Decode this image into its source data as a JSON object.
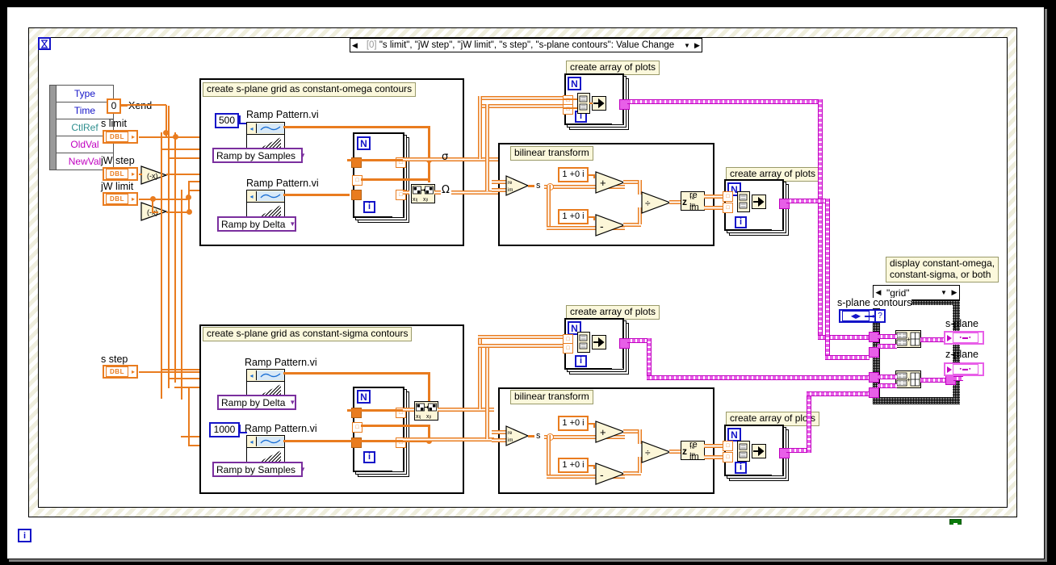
{
  "window": {
    "title_bar_text": "[0] \"s limit\", \"jW step\", \"jW limit\", \"s step\", \"s-plane contours\": Value Change",
    "title_index": "[0]",
    "left_arrow": "◀",
    "right_arrow": "▶",
    "dropdown_arrow": "▼",
    "timeout_icon": "⌛"
  },
  "event_data_node": {
    "items": [
      {
        "label": "Type",
        "color": "#1414c8"
      },
      {
        "label": "Time",
        "color": "#1414c8"
      },
      {
        "label": "CtlRef",
        "color": "#2f8f8f"
      },
      {
        "label": "OldVal",
        "color": "#c000c0"
      },
      {
        "label": "NewVal",
        "color": "#c000c0"
      }
    ]
  },
  "controls": {
    "xend_constant": "0",
    "xend_label": "Xend",
    "s_limit": {
      "label": "s limit",
      "type": "DBL"
    },
    "jw_step": {
      "label": "jW step",
      "type": "DBL"
    },
    "jw_limit": {
      "label": "jW limit",
      "type": "DBL"
    },
    "s_step": {
      "label": "s step",
      "type": "DBL"
    },
    "s_plane_contours": {
      "label": "s-plane contours"
    }
  },
  "frames": {
    "omega": {
      "comment": "create s-plane grid as constant-omega contours",
      "samples_constant": "500",
      "subvi_top": {
        "name": "Ramp Pattern.vi",
        "ring": "Ramp by Samples"
      },
      "subvi_bottom": {
        "name": "Ramp Pattern.vi",
        "ring": "Ramp by Delta"
      },
      "loop_n": "N",
      "loop_i": "i",
      "out_sigma": "σ",
      "out_omega": "Ω"
    },
    "sigma": {
      "comment": "create s-plane grid as constant-sigma contours",
      "samples_constant": "1000",
      "subvi_top": {
        "name": "Ramp Pattern.vi",
        "ring": "Ramp by Delta"
      },
      "subvi_bottom": {
        "name": "Ramp Pattern.vi",
        "ring": "Ramp by Samples"
      },
      "loop_n": "N",
      "loop_i": "i"
    },
    "bilinear_top": {
      "comment": "bilinear transform",
      "const_num": "1 +0 i",
      "const_den": "1 +0 i",
      "s_label": "s",
      "plus": "+",
      "minus": "−",
      "divide": "÷",
      "z_label": "z",
      "re": "re",
      "im": "im"
    },
    "bilinear_bottom": {
      "comment": "bilinear transform",
      "const_num": "1 +0 i",
      "const_den": "1 +0 i",
      "s_label": "s",
      "plus": "+",
      "minus": "−",
      "divide": "÷",
      "z_label": "z",
      "re": "re",
      "im": "im"
    }
  },
  "plot_loops": [
    {
      "comment": "create array of plots",
      "n": "N",
      "i": "i"
    },
    {
      "comment": "create array of plots",
      "n": "N",
      "i": "i"
    },
    {
      "comment": "create array of plots",
      "n": "N",
      "i": "i"
    },
    {
      "comment": "create array of plots",
      "n": "N",
      "i": "i"
    }
  ],
  "case_structure": {
    "comment": "display constant-omega,\nconstant-sigma, or both",
    "selected_case": "\"grid\"",
    "selector_symbol": "?",
    "left_arrow": "◀",
    "right_arrow": "▶",
    "dropdown_arrow": "▼"
  },
  "indicators": {
    "s_plane": "s-plane",
    "z_plane": "z-plane"
  },
  "statusbar": {
    "i_label": "i"
  },
  "colors": {
    "wire_orange": "#e97c1f",
    "wire_pink": "#e85fe8",
    "wire_blue": "#1414c8",
    "wire_green": "#0a7a0a",
    "comment_bg": "#fbf8dc",
    "node_bg": "#fcf6d8"
  }
}
